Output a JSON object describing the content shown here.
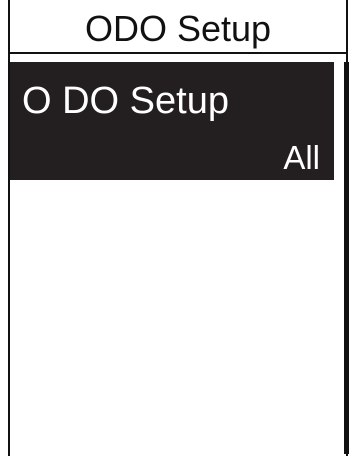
{
  "header": {
    "title": "ODO Setup"
  },
  "menu": {
    "items": [
      {
        "label": "O DO Setup",
        "value": "All",
        "selected": true
      }
    ]
  },
  "colors": {
    "background": "#ffffff",
    "foreground": "#111111",
    "highlight": "#231f20",
    "highlight_text": "#ffffff"
  }
}
